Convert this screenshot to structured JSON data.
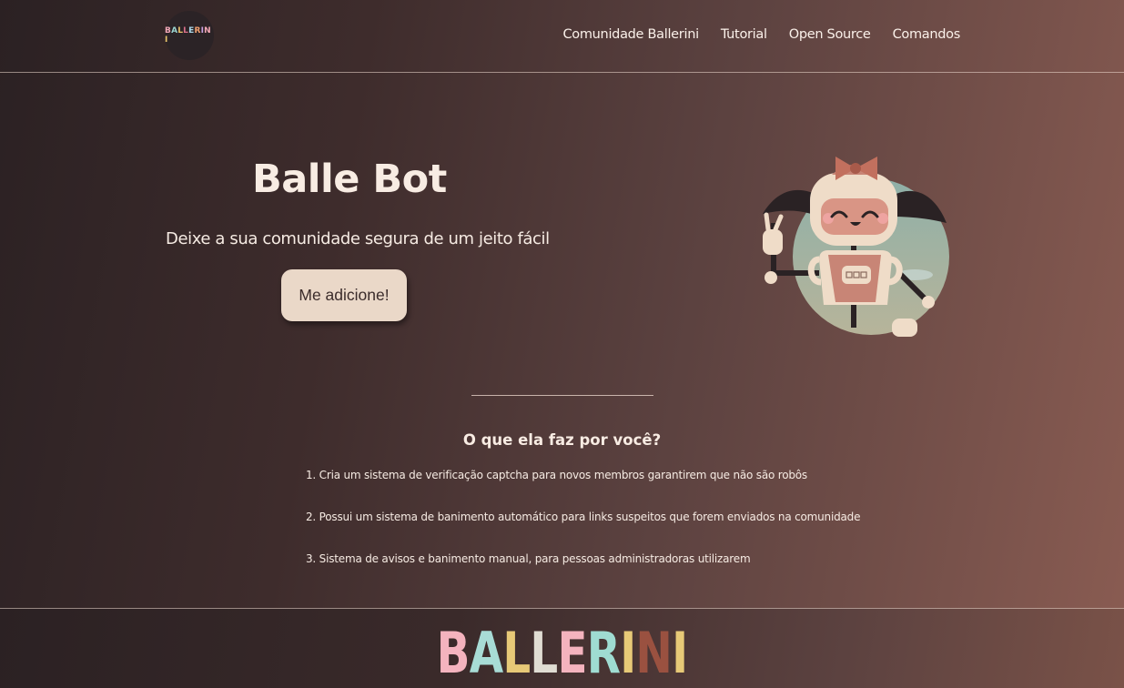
{
  "header": {
    "logo_text": "BALLERINI",
    "logo_colors": [
      "#f2a7b6",
      "#9ad3cf",
      "#e8c36b",
      "#d8708a",
      "#a9d7e8",
      "#f0a070",
      "#c9a0e0",
      "#f2a7b6",
      "#e8c36b"
    ],
    "nav": [
      {
        "label": "Comunidade Ballerini"
      },
      {
        "label": "Tutorial"
      },
      {
        "label": "Open Source"
      },
      {
        "label": "Comandos"
      }
    ]
  },
  "hero": {
    "title": "Balle Bot",
    "subtitle": "Deixe a sua comunidade segura de um jeito fácil",
    "cta_label": "Me adicione!"
  },
  "features": {
    "title": "O que ela faz por você?",
    "items": [
      "1. Cria um sistema de verificação captcha para novos membros garantirem que não são robôs",
      "2. Possui um sistema de banimento automático para links suspeitos que forem enviados na comunidade",
      "3. Sistema de avisos e banimento manual, para pessoas administradoras utilizarem"
    ]
  },
  "footer": {
    "brand": "BALLERINI",
    "brand_colors": [
      "#f4b3be",
      "#a8dcd6",
      "#e7c977",
      "#e0ddd3",
      "#f4b3be",
      "#9fdcd2",
      "#e7c977",
      "#9a5140",
      "#e7c977"
    ]
  },
  "colors": {
    "cta_bg": "#ead8c8",
    "text": "#f6ebe3",
    "robot_body": "#efdcc8",
    "robot_accent": "#c88576"
  },
  "icons": {
    "logo": "ballerini-logo",
    "robot": "robot-mascot-illustration"
  }
}
